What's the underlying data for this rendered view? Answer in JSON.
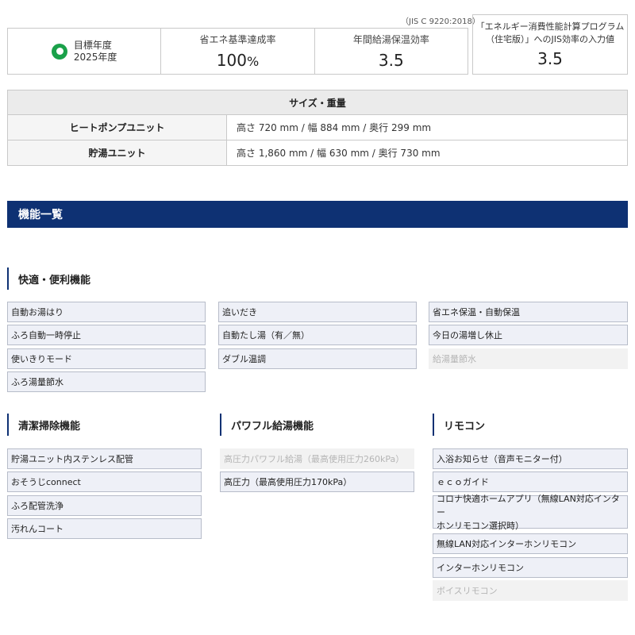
{
  "spec": {
    "jis_note": "（JIS C 9220:2018）",
    "target_year_label": "目標年度",
    "target_year_value": "2025年度",
    "achievement_label": "省エネ基準達成率",
    "achievement_value": "100",
    "achievement_unit": "%",
    "efficiency_label": "年間給湯保温効率",
    "efficiency_value": "3.5",
    "program_note_line1": "「エネルギー消費性能計算プログラム",
    "program_note_line2": "（住宅版）」へのJIS効率の入力値",
    "program_value": "3.5"
  },
  "size_table": {
    "header": "サイズ・重量",
    "rows": [
      {
        "label": "ヒートポンプユニット",
        "value": "高さ 720 mm / 幅 884 mm / 奥行 299 mm"
      },
      {
        "label": "貯湯ユニット",
        "value": "高さ 1,860 mm / 幅 630 mm / 奥行 730 mm"
      }
    ]
  },
  "features_banner": "機能一覧",
  "sections": {
    "comfort": {
      "title": "快適・便利機能",
      "items": [
        "自動お湯はり",
        "ふろ自動一時停止",
        "使いきりモード",
        "ふろ湯量節水",
        "追いだき",
        "自動たし湯（有／無）",
        "ダブル温調",
        "省エネ保温・自動保温",
        "今日の湯増し休止",
        "給湯量節水"
      ]
    },
    "clean": {
      "title": "清潔掃除機能",
      "items": [
        "貯湯ユニット内ステンレス配管",
        "おそうじconnect",
        "ふろ配管洗浄",
        "汚れんコート"
      ]
    },
    "power": {
      "title": "パワフル給湯機能",
      "items": [
        "高圧力パワフル給湯（最高使用圧力260kPa）",
        "高圧力（最高使用圧力170kPa）"
      ]
    },
    "remote": {
      "title": "リモコン",
      "items": [
        "入浴お知らせ（音声モニター付）",
        "ｅｃｏガイド",
        "コロナ快適ホームアプリ（無線LAN対応インター",
        "ホンリモコン選択時）",
        "無線LAN対応インターホンリモコン",
        "インターホンリモコン",
        "ボイスリモコン"
      ]
    }
  },
  "colors": {
    "banner": "#0e3173",
    "item_bg": "#eef0f7",
    "item_border": "#b7bcc9",
    "eco_icon": "#1aa14a"
  }
}
